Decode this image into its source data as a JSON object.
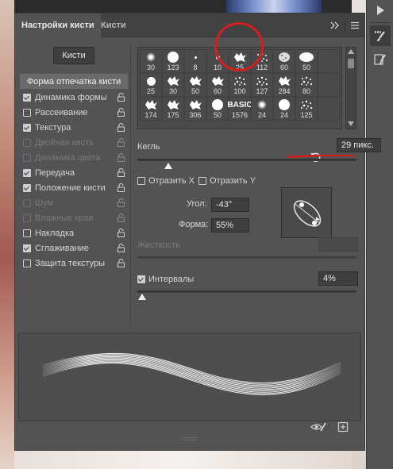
{
  "panel": {
    "tabs": [
      {
        "label": "Настройки кисти",
        "active": true
      },
      {
        "label": "Кисти",
        "active": false
      }
    ],
    "brushes_button": "Кисти",
    "list": [
      {
        "label": "Форма отпечатка кисти",
        "header": true
      },
      {
        "label": "Динамика формы",
        "checked": true,
        "enabled": true
      },
      {
        "label": "Рассеивание",
        "checked": false,
        "enabled": true
      },
      {
        "label": "Текстура",
        "checked": true,
        "enabled": true
      },
      {
        "label": "Двойная кисть",
        "checked": false,
        "enabled": false
      },
      {
        "label": "Динамика цвета",
        "checked": false,
        "enabled": false
      },
      {
        "label": "Передача",
        "checked": true,
        "enabled": true
      },
      {
        "label": "Положение кисти",
        "checked": true,
        "enabled": true
      },
      {
        "label": "Шум",
        "checked": false,
        "enabled": false
      },
      {
        "label": "Влажные края",
        "checked": false,
        "enabled": false
      },
      {
        "label": "Накладка",
        "checked": false,
        "enabled": true
      },
      {
        "label": "Сглаживание",
        "checked": true,
        "enabled": true
      },
      {
        "label": "Защита текстуры",
        "checked": false,
        "enabled": true
      }
    ],
    "brush_presets": [
      {
        "size": "30",
        "shape": "soft"
      },
      {
        "size": "123",
        "shape": "hard-big"
      },
      {
        "size": "8",
        "shape": "hard-tiny"
      },
      {
        "size": "10",
        "shape": "hard-small"
      },
      {
        "size": "25",
        "shape": "splat"
      },
      {
        "size": "112",
        "shape": "spray"
      },
      {
        "size": "60",
        "shape": "textured"
      },
      {
        "size": "50",
        "shape": "hard-oval"
      },
      {
        "size": "",
        "shape": "empty"
      },
      {
        "size": "25",
        "shape": "hard-med"
      },
      {
        "size": "30",
        "shape": "splat"
      },
      {
        "size": "50",
        "shape": "splat"
      },
      {
        "size": "60",
        "shape": "splat"
      },
      {
        "size": "100",
        "shape": "spray"
      },
      {
        "size": "127",
        "shape": "spray"
      },
      {
        "size": "284",
        "shape": "splat"
      },
      {
        "size": "80",
        "shape": "spray"
      },
      {
        "size": "",
        "shape": "empty"
      },
      {
        "size": "174",
        "shape": "splat"
      },
      {
        "size": "175",
        "shape": "splat"
      },
      {
        "size": "306",
        "shape": "splat"
      },
      {
        "size": "50",
        "shape": "hard-big"
      },
      {
        "size": "1576",
        "shape": "basic"
      },
      {
        "size": "24",
        "shape": "soft"
      },
      {
        "size": "24",
        "shape": "hard-big"
      },
      {
        "size": "125",
        "shape": "spray"
      },
      {
        "size": "",
        "shape": "empty"
      }
    ],
    "basic_label": "BASIC",
    "size": {
      "label": "Кегль",
      "value": "29 пикс.",
      "slider_fraction": 0.14
    },
    "flip_x": {
      "label": "Отразить X",
      "checked": false
    },
    "flip_y": {
      "label": "Отразить Y",
      "checked": false
    },
    "angle": {
      "label": "Угол:",
      "value": "-43°"
    },
    "roundness": {
      "label": "Форма:",
      "value": "55%"
    },
    "hardness": {
      "label": "Жесткость",
      "enabled": false
    },
    "spacing": {
      "label": "Интервалы",
      "checked": true,
      "value": "4%",
      "slider_fraction": 0.02
    }
  },
  "colors": {
    "panel_bg": "#535353",
    "annotation_red": "#d51f1f",
    "highlight_header": "#6a6a6a"
  },
  "icons": {
    "tab_collapse": "double-chevron-right-icon",
    "tab_menu": "hamburger-menu-icon",
    "reset": "reset-arrow-icon",
    "preview_toggle": "eye-brush-icon",
    "new_preset": "new-preset-icon",
    "toolbar": [
      "play-icon",
      "brush-settings-icon",
      "brushes-icon"
    ]
  }
}
